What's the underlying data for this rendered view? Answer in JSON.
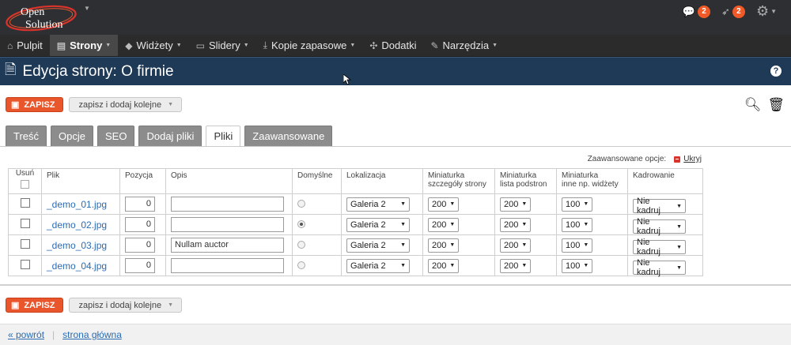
{
  "app": {
    "logo_line1": "Open",
    "logo_line2": "Solution"
  },
  "topbar": {
    "messages_count": "2",
    "notifications_count": "2"
  },
  "nav": {
    "items": [
      {
        "label": "Pulpit",
        "icon": "home-icon"
      },
      {
        "label": "Strony",
        "icon": "file-icon",
        "active": true
      },
      {
        "label": "Widżety",
        "icon": "cube-icon"
      },
      {
        "label": "Slidery",
        "icon": "slides-icon"
      },
      {
        "label": "Kopie zapasowe",
        "icon": "download-icon"
      },
      {
        "label": "Dodatki",
        "icon": "puzzle-icon"
      },
      {
        "label": "Narzędzia",
        "icon": "wrench-icon"
      }
    ]
  },
  "page": {
    "title": "Edycja strony: O firmie"
  },
  "toolbar": {
    "save_label": "ZAPISZ",
    "save_more_label": "zapisz i dodaj kolejne"
  },
  "tabs": [
    "Treść",
    "Opcje",
    "SEO",
    "Dodaj pliki",
    "Pliki",
    "Zaawansowane"
  ],
  "active_tab": "Pliki",
  "advanced": {
    "label": "Zaawansowane opcje:",
    "hide_link": "Ukryj"
  },
  "table": {
    "headers": {
      "usun": "Usuń",
      "plik": "Plik",
      "pozycja": "Pozycja",
      "opis": "Opis",
      "domyslne": "Domyślne",
      "lokalizacja": "Lokalizacja",
      "min_szczegoly_1": "Miniaturka",
      "min_szczegoly_2": "szczegóły strony",
      "min_lista_1": "Miniaturka",
      "min_lista_2": "lista podstron",
      "min_inne_1": "Miniaturka",
      "min_inne_2": "inne np. widżety",
      "kadrowanie": "Kadrowanie"
    },
    "rows": [
      {
        "file": "_demo_01.jpg",
        "position": "0",
        "description": "",
        "default": false,
        "location": "Galeria 2",
        "thumb_detail": "200",
        "thumb_list": "200",
        "thumb_other": "100",
        "crop": "Nie kadruj"
      },
      {
        "file": "_demo_02.jpg",
        "position": "0",
        "description": "",
        "default": true,
        "location": "Galeria 2",
        "thumb_detail": "200",
        "thumb_list": "200",
        "thumb_other": "100",
        "crop": "Nie kadruj"
      },
      {
        "file": "_demo_03.jpg",
        "position": "0",
        "description": "Nullam auctor",
        "default": false,
        "location": "Galeria 2",
        "thumb_detail": "200",
        "thumb_list": "200",
        "thumb_other": "100",
        "crop": "Nie kadruj"
      },
      {
        "file": "_demo_04.jpg",
        "position": "0",
        "description": "",
        "default": false,
        "location": "Galeria 2",
        "thumb_detail": "200",
        "thumb_list": "200",
        "thumb_other": "100",
        "crop": "Nie kadruj"
      }
    ]
  },
  "footer": {
    "back_label": "« powrót",
    "home_label": "strona główna"
  },
  "colors": {
    "accent": "#e9562c",
    "titlebar": "#1f3a56",
    "link": "#2a6cb4"
  }
}
